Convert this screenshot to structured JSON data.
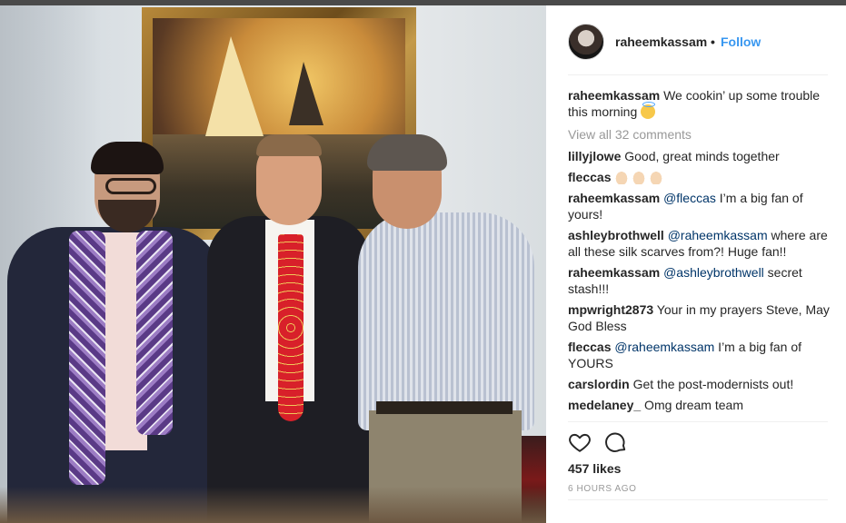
{
  "post": {
    "username": "raheemkassam",
    "separator": "•",
    "follow_label": "Follow",
    "caption_user": "raheemkassam",
    "caption_text": " We cookin’ up some trouble this morning ",
    "caption_emoji": "smiling-face-with-halo",
    "view_all": "View all 32 comments",
    "comments": [
      {
        "user": "lillyjlowe",
        "mention": "",
        "text": " Good, great minds together"
      },
      {
        "user": "fleccas",
        "mention": "",
        "text": " ",
        "emoji": "clapping-hands-x3"
      },
      {
        "user": "raheemkassam",
        "mention": " @fleccas",
        "text": " I’m a big fan of yours!"
      },
      {
        "user": "ashleybrothwell",
        "mention": " @raheemkassam",
        "text": " where are all these silk scarves from?! Huge fan!!"
      },
      {
        "user": "raheemkassam",
        "mention": " @ashleybrothwell",
        "text": " secret stash!!!"
      },
      {
        "user": "mpwright2873",
        "mention": "",
        "text": " Your in my prayers Steve, May God Bless"
      },
      {
        "user": "fleccas",
        "mention": " @raheemkassam",
        "text": " I’m a big fan of YOURS"
      },
      {
        "user": "carslordin",
        "mention": "",
        "text": " Get the post-modernists out!"
      },
      {
        "user": "medelaney_",
        "mention": "",
        "text": " Omg dream team"
      }
    ],
    "likes": "457 likes",
    "time": "6 HOURS AGO"
  },
  "icons": {
    "like": "heart-icon",
    "comment": "comment-bubble-icon"
  },
  "colors": {
    "link_blue": "#3897f0",
    "mention_navy": "#003569",
    "muted": "#999999",
    "text": "#262626"
  }
}
